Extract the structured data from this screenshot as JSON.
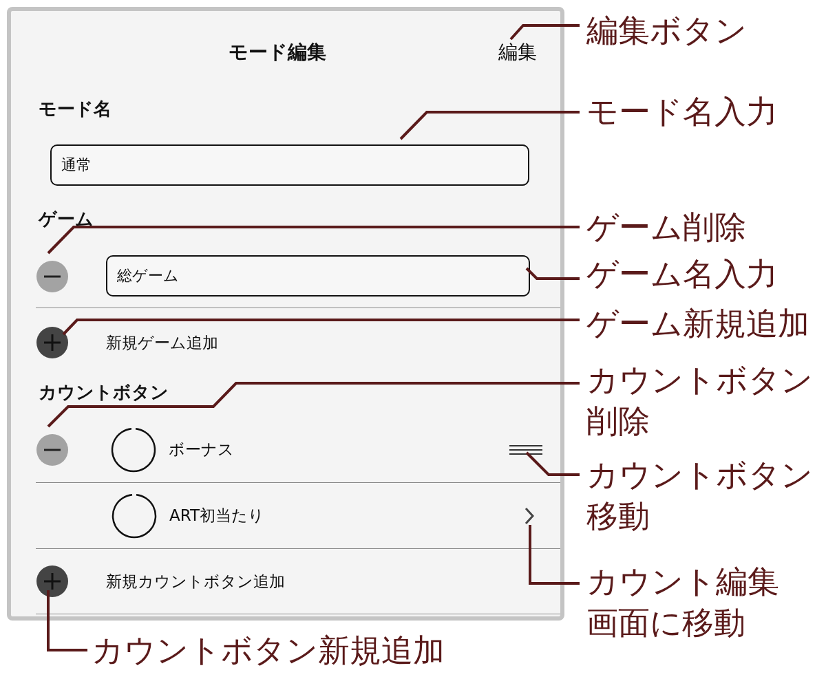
{
  "header": {
    "title": "モード編集",
    "edit_button": "編集"
  },
  "mode_name": {
    "label": "モード名",
    "value": "通常"
  },
  "games": {
    "label": "ゲーム",
    "items": [
      {
        "value": "総ゲーム",
        "deletable": true
      }
    ],
    "add_label": "新規ゲーム追加"
  },
  "count_buttons": {
    "label": "カウントボタン",
    "items": [
      {
        "name": "ボーナス",
        "deletable": true,
        "kind": "reorder"
      },
      {
        "name": "ART初当たり",
        "deletable": false,
        "kind": "detail"
      }
    ],
    "add_label": "新規カウントボタン追加"
  },
  "callouts": [
    {
      "text": "編集ボタン"
    },
    {
      "text": "モード名入力"
    },
    {
      "text": "ゲーム削除"
    },
    {
      "text": "ゲーム名入力"
    },
    {
      "text": "ゲーム新規追加"
    },
    {
      "text": "カウントボタン削除"
    },
    {
      "text": "カウントボタン移動"
    },
    {
      "text": "カウント編集画面に移動"
    },
    {
      "text": "カウントボタン新規追加"
    }
  ]
}
